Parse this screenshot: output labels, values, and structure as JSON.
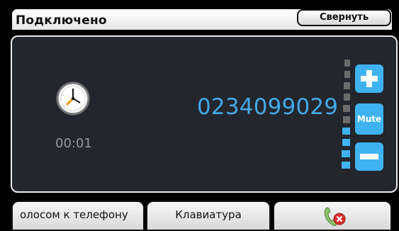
{
  "header": {
    "title": "Подключено",
    "collapse_label": "Свернуть"
  },
  "call": {
    "duration": "00:01",
    "phone_number": "0234099029"
  },
  "controls": {
    "volume_up_icon": "plus-icon",
    "mute_label": "Mute",
    "volume_down_icon": "minus-icon",
    "volume_level": 0.4
  },
  "footer": {
    "voice_to_phone_label": "олосом к телефону",
    "keyboard_label": "Клавиатура",
    "hangup_icon": "hangup-phone-icon"
  },
  "colors": {
    "accent": "#42a9e8",
    "active_volume": "#3fb3f2",
    "inactive_volume": "#6b6b6b",
    "panel_bg": "#23262c"
  }
}
